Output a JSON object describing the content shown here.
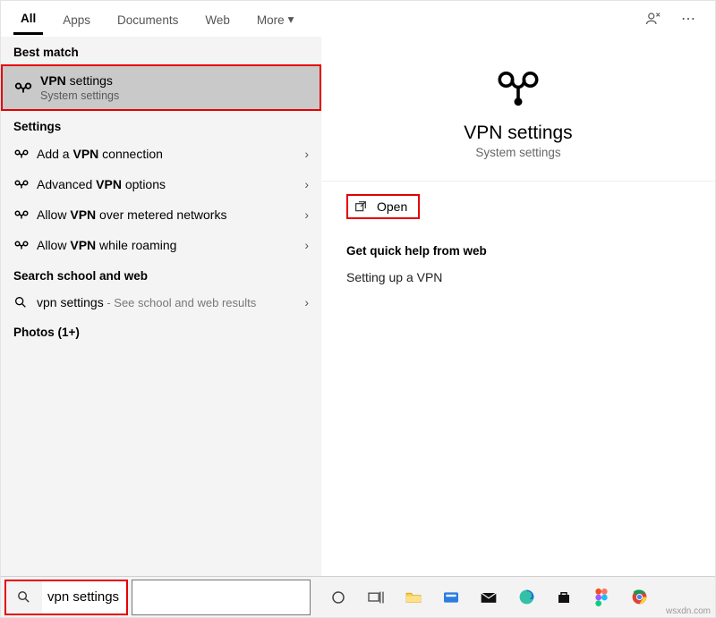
{
  "filterbar": {
    "tabs": [
      "All",
      "Apps",
      "Documents",
      "Web",
      "More"
    ],
    "active_index": 0
  },
  "left": {
    "best_match_label": "Best match",
    "best_match": {
      "title_prefix": "VPN",
      "title_rest": " settings",
      "subtitle": "System settings"
    },
    "settings_label": "Settings",
    "settings_items": [
      {
        "prefix": "Add a ",
        "bold": "VPN",
        "suffix": " connection"
      },
      {
        "prefix": "Advanced ",
        "bold": "VPN",
        "suffix": " options"
      },
      {
        "prefix": "Allow ",
        "bold": "VPN",
        "suffix": " over metered networks"
      },
      {
        "prefix": "Allow ",
        "bold": "VPN",
        "suffix": " while roaming"
      }
    ],
    "school_web_label": "Search school and web",
    "school_web_item": {
      "query": "vpn settings",
      "suffix": " - See school and web results"
    },
    "photos_label": "Photos (1+)"
  },
  "right": {
    "hero_title": "VPN settings",
    "hero_sub": "System settings",
    "open_label": "Open",
    "quickhelp_head": "Get quick help from web",
    "quickhelp_item": "Setting up a VPN"
  },
  "taskbar": {
    "search_value": "vpn settings"
  },
  "watermark": "wsxdn.com"
}
